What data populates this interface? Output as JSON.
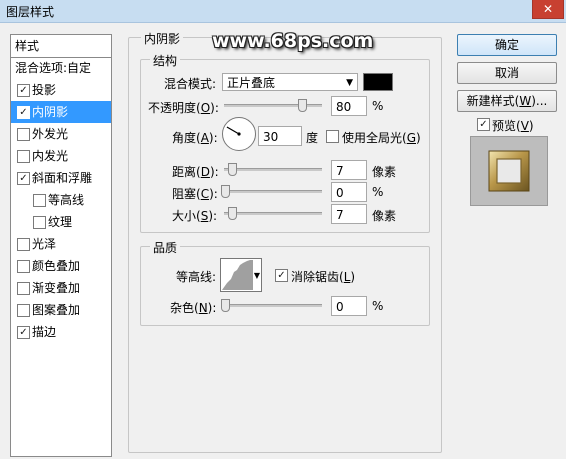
{
  "window": {
    "title": "图层样式",
    "close": "✕"
  },
  "watermark": "www.68ps.com",
  "styles_list": {
    "header": "样式",
    "items": [
      {
        "label": "混合选项:自定",
        "has_checkbox": false,
        "checked": false,
        "selected": false
      },
      {
        "label": "投影",
        "has_checkbox": true,
        "checked": true,
        "selected": false
      },
      {
        "label": "内阴影",
        "has_checkbox": true,
        "checked": true,
        "selected": true
      },
      {
        "label": "外发光",
        "has_checkbox": true,
        "checked": false,
        "selected": false
      },
      {
        "label": "内发光",
        "has_checkbox": true,
        "checked": false,
        "selected": false
      },
      {
        "label": "斜面和浮雕",
        "has_checkbox": true,
        "checked": true,
        "selected": false
      },
      {
        "label": "等高线",
        "has_checkbox": true,
        "checked": false,
        "selected": false,
        "indent": true
      },
      {
        "label": "纹理",
        "has_checkbox": true,
        "checked": false,
        "selected": false,
        "indent": true
      },
      {
        "label": "光泽",
        "has_checkbox": true,
        "checked": false,
        "selected": false
      },
      {
        "label": "颜色叠加",
        "has_checkbox": true,
        "checked": false,
        "selected": false
      },
      {
        "label": "渐变叠加",
        "has_checkbox": true,
        "checked": false,
        "selected": false
      },
      {
        "label": "图案叠加",
        "has_checkbox": true,
        "checked": false,
        "selected": false
      },
      {
        "label": "描边",
        "has_checkbox": true,
        "checked": true,
        "selected": false
      }
    ]
  },
  "inner_shadow": {
    "title": "内阴影",
    "structure": {
      "title": "结构",
      "blend_mode_label": "混合模式:",
      "blend_mode_value": "正片叠底",
      "color": "#000000",
      "opacity_label_pre": "不透明度(",
      "opacity_key": "O",
      "opacity_label_post": "):",
      "opacity_value": "80",
      "opacity_unit": "%",
      "opacity_fraction": 0.8,
      "angle_label_pre": "角度(",
      "angle_key": "A",
      "angle_label_post": "):",
      "angle_value": "30",
      "angle_unit": "度",
      "angle_degrees": 30,
      "global_light_label_pre": "使用全局光(",
      "global_light_key": "G",
      "global_light_label_post": ")",
      "global_light_checked": false,
      "distance_label_pre": "距离(",
      "distance_key": "D",
      "distance_label_post": "):",
      "distance_value": "7",
      "distance_unit": "像素",
      "choke_label_pre": "阻塞(",
      "choke_key": "C",
      "choke_label_post": "):",
      "choke_value": "0",
      "choke_unit": "%",
      "size_label_pre": "大小(",
      "size_key": "S",
      "size_label_post": "):",
      "size_value": "7",
      "size_unit": "像素"
    },
    "quality": {
      "title": "品质",
      "contour_label": "等高线:",
      "antialias_label_pre": "消除锯齿(",
      "antialias_key": "L",
      "antialias_label_post": ")",
      "antialias_checked": true,
      "noise_label_pre": "杂色(",
      "noise_key": "N",
      "noise_label_post": "):",
      "noise_value": "0",
      "noise_unit": "%"
    }
  },
  "buttons": {
    "ok": "确定",
    "cancel": "取消",
    "new_style_pre": "新建样式(",
    "new_style_key": "W",
    "new_style_post": ")...",
    "preview_pre": "预览(",
    "preview_key": "V",
    "preview_post": ")",
    "preview_checked": true
  }
}
